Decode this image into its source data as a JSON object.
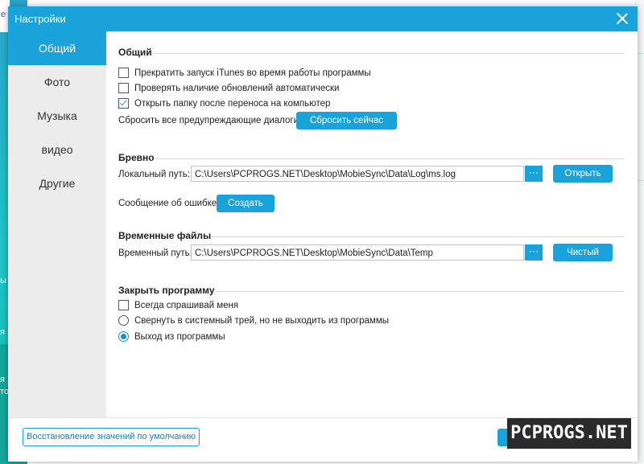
{
  "background": {
    "top_left_text": "e",
    "left_fragments": [
      "ы",
      "я",
      "я",
      "то"
    ]
  },
  "dialog": {
    "title": "Настройки"
  },
  "sidebar": {
    "items": [
      {
        "label": "Общий",
        "active": true
      },
      {
        "label": "Фото",
        "active": false
      },
      {
        "label": "Музыка",
        "active": false
      },
      {
        "label": "видео",
        "active": false
      },
      {
        "label": "Другие",
        "active": false
      }
    ]
  },
  "general": {
    "title": "Общий",
    "options": [
      {
        "label": "Прекратить запуск iTunes во время работы программы",
        "checked": false
      },
      {
        "label": "Проверять наличие обновлений автоматически",
        "checked": false
      },
      {
        "label": "Открыть папку после переноса на компьютер",
        "checked": true
      }
    ],
    "reset_label": "Сбросить все предупреждающие диалоги:",
    "reset_button": "Сбросить сейчас"
  },
  "log": {
    "title": "Бревно",
    "path_label": "Локальный путь:",
    "path_value": "C:\\Users\\PCPROGS.NET\\Desktop\\MobieSync\\Data\\Log\\ms.log",
    "browse_label": "···",
    "open_button": "Открыть",
    "error_label": "Сообщение об ошибке:",
    "create_button": "Создать"
  },
  "temp": {
    "title": "Временные файлы",
    "path_label": "Временный путь:",
    "path_value": "C:\\Users\\PCPROGS.NET\\Desktop\\MobieSync\\Data\\Temp",
    "browse_label": "···",
    "clear_button": "Чистый"
  },
  "close_program": {
    "title": "Закрыть программу",
    "always_ask": {
      "label": "Всегда спрашивай меня",
      "checked": false
    },
    "radios": [
      {
        "label": "Свернуть в системный трей, но не выходить из программы",
        "checked": false
      },
      {
        "label": "Выход из программы",
        "checked": true
      }
    ]
  },
  "footer": {
    "restore_button": "Восстановление значений по умолчанию"
  },
  "watermark": {
    "text": "PCPROGS.NET"
  },
  "colors": {
    "accent": "#1aa3da",
    "sidebar_bg": "#ececec"
  }
}
